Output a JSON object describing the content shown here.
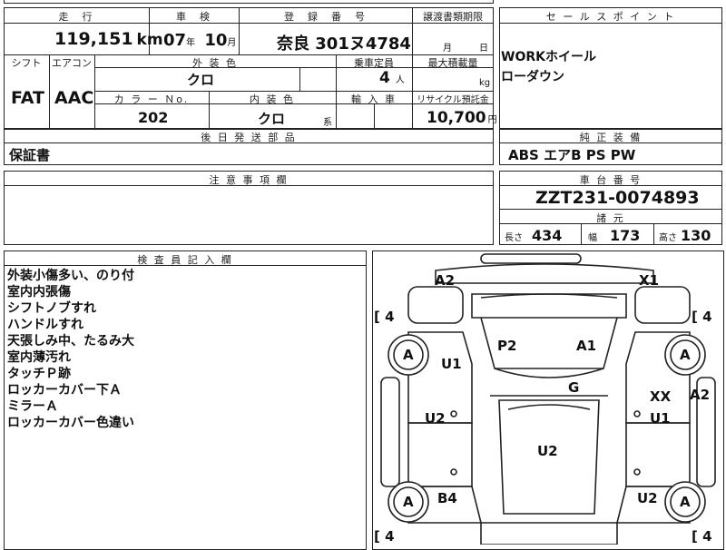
{
  "top_header": {
    "mileage_label": "走　行",
    "inspection_label": "車　検",
    "registration_label": "登　録　番　号",
    "transfer_doc_label": "譲渡書類期限"
  },
  "top_values": {
    "mileage": "119,151",
    "mileage_unit": "km",
    "inspection_year": "07",
    "year_unit": "年",
    "inspection_month": "10",
    "month_unit": "月",
    "registration": "奈良 301ヌ4784",
    "transfer_month_unit": "月",
    "transfer_day_unit": "日"
  },
  "mid_header": {
    "shift_label": "シフト",
    "ac_label": "エアコン",
    "exterior_color_label": "外 装 色",
    "capacity_label": "乗車定員",
    "max_load_label": "最大積載量"
  },
  "mid_values": {
    "shift": "FAT",
    "ac": "AAC",
    "exterior_color": "クロ",
    "capacity": "4",
    "capacity_unit": "人",
    "load_unit": "kg"
  },
  "row3_header": {
    "color_no_label": "カ ラ ー Ｎo.",
    "interior_color_label": "内 装 色",
    "import_label": "輸 入 車",
    "recycle_label": "リサイクル預託金"
  },
  "row3_values": {
    "color_no": "202",
    "interior_color": "クロ",
    "interior_suffix": "系",
    "recycle_fee": "10,700",
    "recycle_unit": "円"
  },
  "later_parts": {
    "label": "後 日 発 送 部 品",
    "value": "保証書"
  },
  "sales_point": {
    "label": "セ ー ル ス ポ イ ン ト",
    "lines": [
      "WORKホイール",
      "ローダウン"
    ]
  },
  "standard_equipment": {
    "label": "純 正 装 備",
    "value": "ABS エアB PS PW"
  },
  "caution": {
    "label": "注 意 事 項 欄"
  },
  "chassis": {
    "label": "車 台 番 号",
    "value": "ZZT231-0074893"
  },
  "specs": {
    "label": "諸 元",
    "length_label": "長さ",
    "length": "434",
    "width_label": "幅",
    "width": "173",
    "height_label": "高さ",
    "height": "130"
  },
  "inspector": {
    "label": "検 査 員 記 入 欄",
    "notes": [
      "外装小傷多い、のり付",
      "室内内張傷",
      "シフトノブすれ",
      "ハンドルすれ",
      "天張しみ中、たるみ大",
      "室内薄汚れ",
      "タッチＰ跡",
      "ロッカーカバー下Ａ",
      "ミラーＡ",
      "ロッカーカバー色違い"
    ]
  },
  "diagram": {
    "tire_depth": "4",
    "tire_label": "A",
    "marks": {
      "front_left": "A2",
      "front_right": "X1",
      "hood_left": "P2",
      "hood_right": "A1",
      "left_fender": "U1",
      "windshield": "G",
      "right_fender_xx": "XX",
      "right_side": "A2",
      "left_door": "U2",
      "right_door": "U1",
      "roof": "U2",
      "left_rear": "B4",
      "right_rear": "U2"
    }
  }
}
